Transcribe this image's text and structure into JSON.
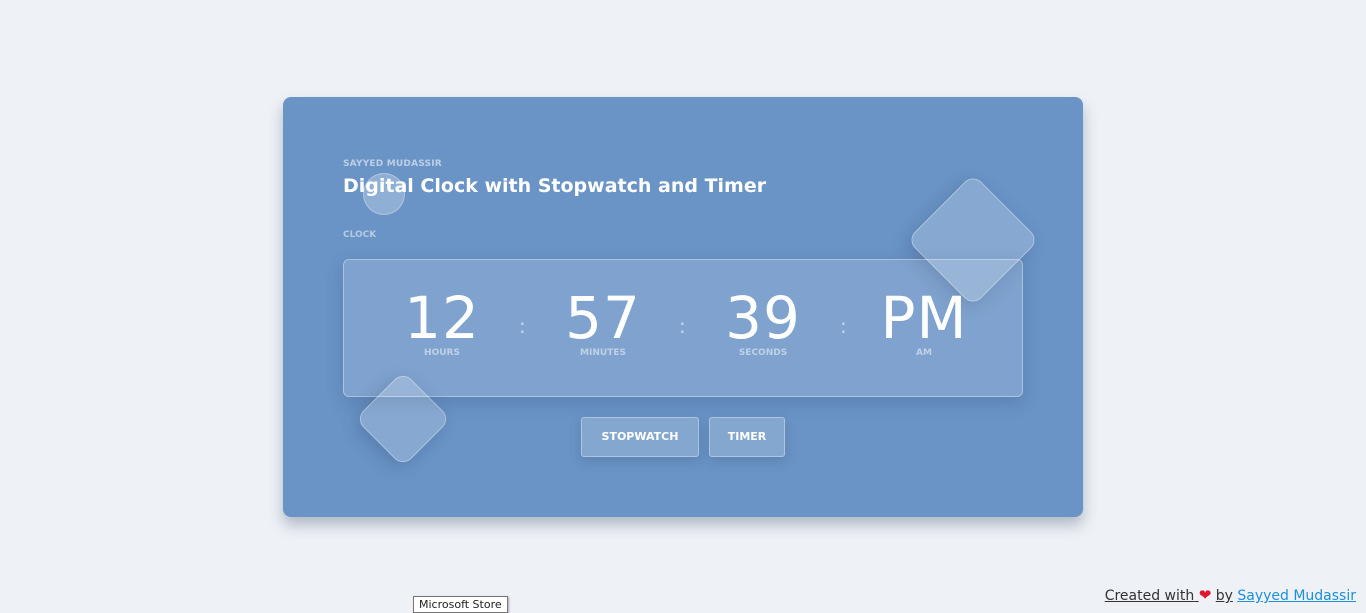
{
  "card": {
    "author": "SAYYED MUDASSIR",
    "title": "Digital Clock with Stopwatch and Timer",
    "section_label": "CLOCK"
  },
  "clock": {
    "hours": "12",
    "hours_label": "HOURS",
    "minutes": "57",
    "minutes_label": "MINUTES",
    "seconds": "39",
    "seconds_label": "SECONDS",
    "period": "PM",
    "period_label": "AM",
    "separator": ":"
  },
  "buttons": {
    "stopwatch": "STOPWATCH",
    "timer": "TIMER"
  },
  "footer": {
    "created_with": "Created with",
    "heart_icon": "heart-icon",
    "by": "by",
    "author": "Sayyed Mudassir"
  },
  "tooltip": {
    "text": "Microsoft Store"
  },
  "colors": {
    "background": "#eef1f6",
    "card": "#6a94c6",
    "link": "#1e90d6",
    "heart": "#e0152f"
  }
}
